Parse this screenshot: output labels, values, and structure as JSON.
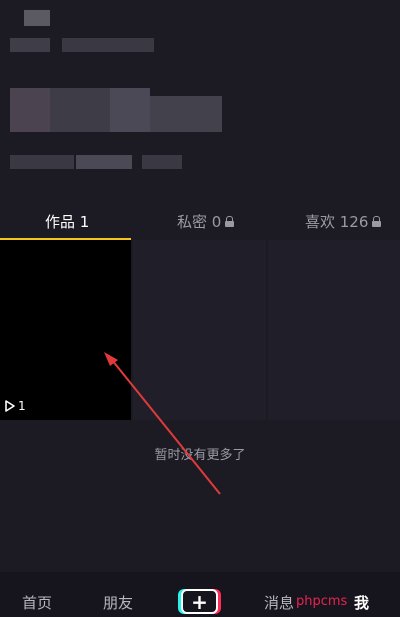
{
  "tabs": [
    {
      "label": "作品 1",
      "locked": false,
      "active": true
    },
    {
      "label": "私密 0",
      "locked": true,
      "active": false
    },
    {
      "label": "喜欢 126",
      "locked": true,
      "active": false
    }
  ],
  "video": {
    "play_count": "1"
  },
  "empty_message": "暂时没有更多了",
  "nav": {
    "home": "首页",
    "friends": "朋友",
    "add": "+",
    "messages": "消息",
    "me": "我"
  },
  "watermark": "phpcms",
  "colors": {
    "background": "#1c1b24",
    "tab_indicator": "#f2c81f",
    "annotation_arrow": "#e03a3a",
    "watermark": "#e8234f"
  }
}
